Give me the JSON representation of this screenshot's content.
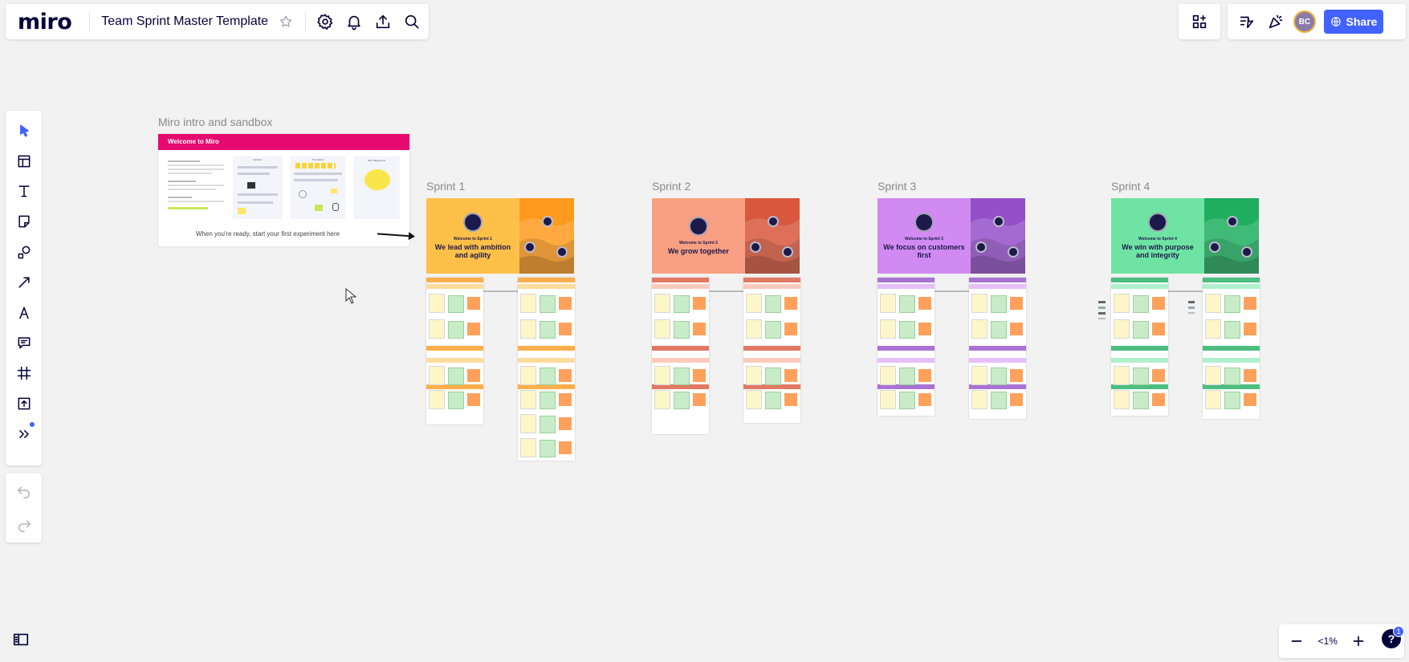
{
  "app": {
    "logo": "miro",
    "board_title": "Team Sprint Master Template"
  },
  "header": {
    "share_label": "Share",
    "avatar_initials": "BC"
  },
  "toolbar": {
    "tools": [
      "select-icon",
      "templates-icon",
      "text-icon",
      "sticky-note-icon",
      "shapes-icon",
      "connection-line-icon",
      "pen-icon",
      "comment-icon",
      "frame-icon",
      "upload-icon",
      "more-tools-icon"
    ]
  },
  "zoom": {
    "value": "<1%"
  },
  "help": {
    "glyph": "?",
    "badge": "1"
  },
  "canvas": {
    "intro": {
      "label": "Miro intro and sandbox",
      "header": "Welcome to Miro",
      "cta": "When you're ready, start your first experiment here",
      "panels": [
        "Interface",
        "The basics",
        "Miro Playground"
      ]
    },
    "sprints": [
      {
        "label": "Sprint 1",
        "hero_sub": "Welcome to Sprint 1",
        "hero_title": "We lead with ambition and agility",
        "color": "#ffc04a",
        "accent": "#ff9a1f"
      },
      {
        "label": "Sprint 2",
        "hero_sub": "Welcome to Sprint 2",
        "hero_title": "We grow together",
        "color": "#f99f83",
        "accent": "#d9583d"
      },
      {
        "label": "Sprint 3",
        "hero_sub": "Welcome to Sprint 3",
        "hero_title": "We focus on customers first",
        "color": "#d18af2",
        "accent": "#9450c9"
      },
      {
        "label": "Sprint 4",
        "hero_sub": "Welcome to Sprint 4",
        "hero_title": "We win with purpose and integrity",
        "color": "#6fe3a4",
        "accent": "#1fae60"
      }
    ]
  }
}
